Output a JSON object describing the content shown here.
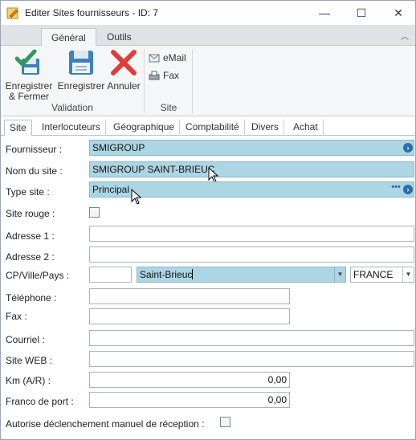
{
  "window": {
    "title": "Editer Sites fournisseurs - ID: 7",
    "minimize": "—",
    "maximize": "☐",
    "close": "✕"
  },
  "ribbon": {
    "tabs": [
      {
        "label": "Général",
        "active": true
      },
      {
        "label": "Outils",
        "active": false
      }
    ],
    "collapse_icon": "chevron-up-icon",
    "groups": {
      "validation": {
        "label": "Validation",
        "buttons": {
          "save_close_line1": "Enregistrer",
          "save_close_line2": "& Fermer",
          "save": "Enregistrer",
          "cancel": "Annuler"
        }
      },
      "site": {
        "label": "Site",
        "email": "eMail",
        "fax": "Fax"
      }
    }
  },
  "form_tabs": [
    "Site",
    "Interlocuteurs",
    "Géographique",
    "Comptabilité",
    "Divers",
    "Achat"
  ],
  "form": {
    "fournisseur": {
      "label": "Fournisseur :",
      "value": "SMIGROUP"
    },
    "nom_site": {
      "label": "Nom du site :",
      "value": "SMIGROUP SAINT-BRIEUC"
    },
    "type_site": {
      "label": "Type site :",
      "value": "Principal"
    },
    "site_rouge": {
      "label": "Site rouge :",
      "checked": false
    },
    "adresse1": {
      "label": "Adresse 1 :",
      "value": ""
    },
    "adresse2": {
      "label": "Adresse 2 :",
      "value": ""
    },
    "cp_ville_pays": {
      "label": "CP/Ville/Pays :",
      "cp": "",
      "ville": "Saint-Brieuc",
      "pays": "FRANCE"
    },
    "telephone": {
      "label": "Téléphone :",
      "value": ""
    },
    "fax": {
      "label": "Fax :",
      "value": ""
    },
    "courriel": {
      "label": "Courriel :",
      "value": ""
    },
    "site_web": {
      "label": "Site WEB :",
      "value": ""
    },
    "km": {
      "label": "Km (A/R) :",
      "value": "0,00"
    },
    "franco": {
      "label": "Franco de port :",
      "value": "0,00"
    },
    "autorise": {
      "label": "Autorise déclenchement manuel de réception :",
      "checked": false
    }
  },
  "colors": {
    "highlight_field": "#add6e4",
    "accent_blue": "#2a6db0",
    "save_green": "#2e9b5a",
    "cancel_red": "#e23b3b"
  }
}
